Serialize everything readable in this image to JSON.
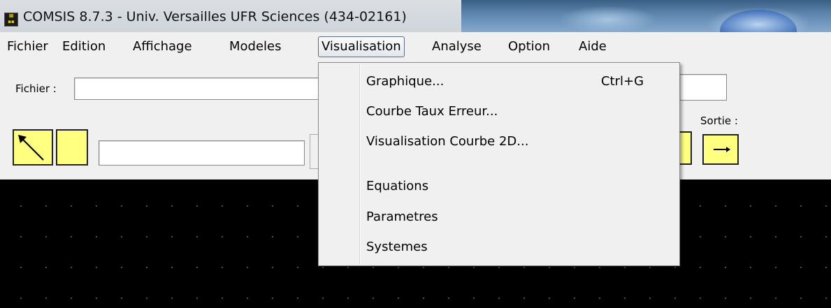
{
  "window": {
    "title": "COMSIS 8.7.3 - Univ. Versailles UFR Sciences (434-02161)",
    "icon": "app-icon"
  },
  "menubar": {
    "items": [
      "Fichier",
      "Edition",
      "Affichage",
      "Modeles",
      "Visualisation",
      "Analyse",
      "Option",
      "Aide"
    ],
    "active": "Visualisation"
  },
  "toolbar": {
    "fichier_label": "Fichier :",
    "fichier_value": "",
    "sortie_label": "Sortie :",
    "text_field_value": ""
  },
  "visualisation_menu": {
    "items": [
      {
        "label": "Graphique...",
        "shortcut": "Ctrl+G"
      },
      {
        "label": "Courbe Taux Erreur...",
        "shortcut": ""
      },
      {
        "label": "Visualisation Courbe 2D...",
        "shortcut": ""
      },
      {
        "label": "Equations",
        "shortcut": ""
      },
      {
        "label": "Parametres",
        "shortcut": ""
      },
      {
        "label": "Systemes",
        "shortcut": ""
      }
    ]
  },
  "colors": {
    "button_yellow": "#ffff80",
    "canvas_background": "#000000"
  },
  "icons": {
    "pointer_tool": "arrow-pointer-icon",
    "output_arrow": "right-arrow-icon"
  }
}
